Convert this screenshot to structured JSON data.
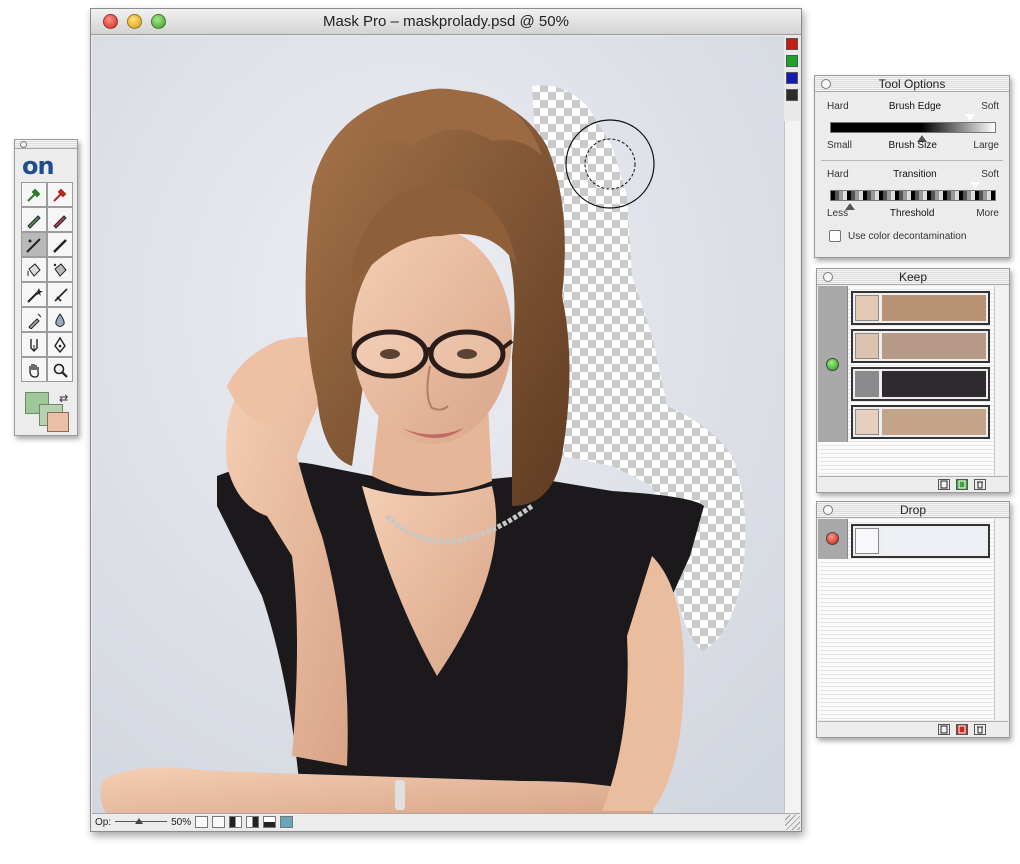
{
  "document": {
    "title": "Mask Pro – maskprolady.psd @ 50%",
    "channel_chips": [
      "#c41c14",
      "#1fa22c",
      "#141ab0",
      "#2c2c2c"
    ],
    "status": {
      "op_label": "Op:",
      "zoom": "50%"
    }
  },
  "tools_palette": {
    "logo": "on",
    "tools": [
      "keep-eyedropper-icon",
      "drop-eyedropper-icon",
      "keep-highlighter-icon",
      "drop-highlighter-icon",
      "magic-brush-icon",
      "brush-icon",
      "bucket-fill-icon",
      "magic-bucket-icon",
      "magic-wand-icon",
      "chisel-icon",
      "magic-pen-icon",
      "blur-icon",
      "pen-icon",
      "pen-tool-icon",
      "hand-icon",
      "zoom-icon"
    ],
    "selected_tool_index": 4,
    "colors": {
      "keep": "#9fc79a",
      "drop": "#e9bfa7"
    }
  },
  "tool_options": {
    "title": "Tool Options",
    "brush_edge": {
      "left": "Hard",
      "label": "Brush Edge",
      "right": "Soft"
    },
    "brush_size": {
      "left": "Small",
      "label": "Brush Size",
      "right": "Large"
    },
    "transition": {
      "left": "Hard",
      "label": "Transition",
      "right": "Soft"
    },
    "threshold": {
      "left": "Less",
      "label": "Threshold",
      "right": "More"
    },
    "color_decontamination": {
      "label": "Use color decontamination",
      "checked": false
    }
  },
  "keep_palette": {
    "title": "Keep",
    "active": true,
    "colors": [
      {
        "thumb": "#e3c8b2",
        "bar": "#b89374"
      },
      {
        "thumb": "#dcc3b0",
        "bar": "#b79987"
      },
      {
        "thumb": "#8a8b8f",
        "bar": "#2e2a30"
      },
      {
        "thumb": "#e6cfbe",
        "bar": "#c4a489"
      }
    ]
  },
  "drop_palette": {
    "title": "Drop",
    "active": true,
    "colors": [
      {
        "thumb": "#f6f8fc",
        "bar": "#edf0f5"
      }
    ]
  }
}
